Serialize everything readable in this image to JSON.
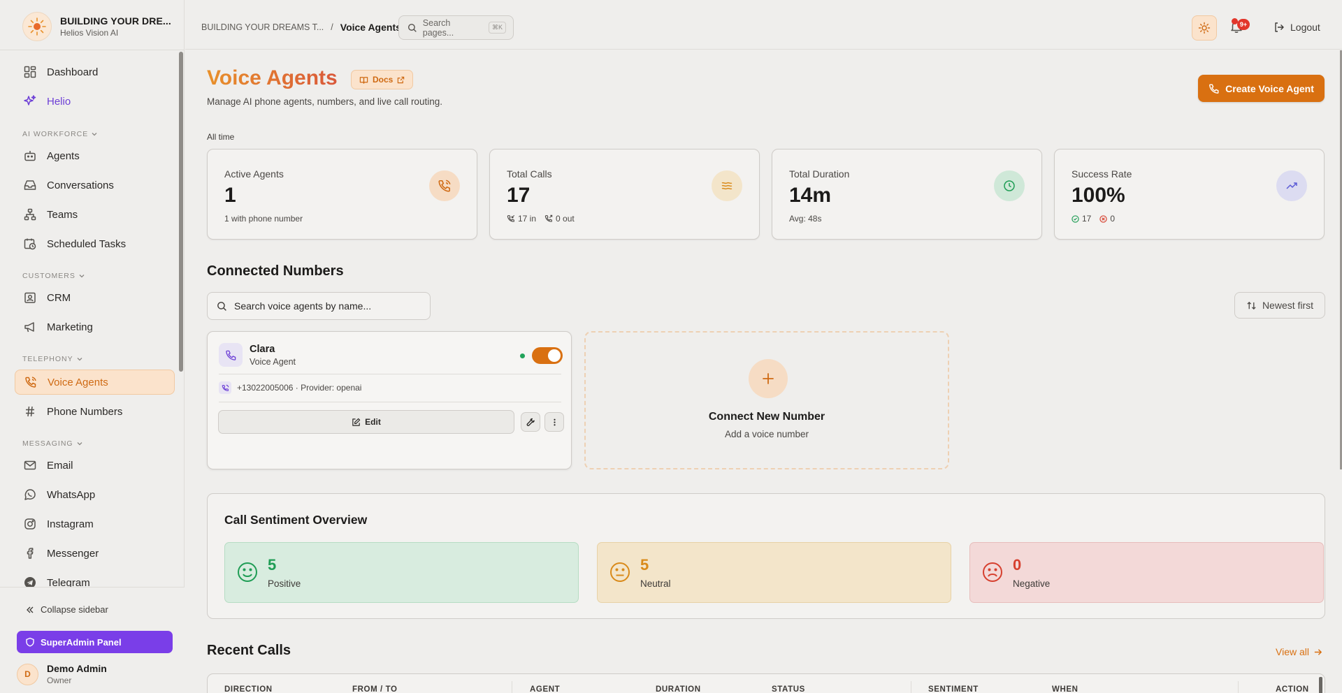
{
  "brand": {
    "name": "BUILDING YOUR DRE...",
    "subtitle": "Helios Vision AI"
  },
  "sidebar": {
    "items": [
      {
        "label": "Dashboard",
        "icon": "dashboard-grid-icon"
      },
      {
        "label": "Helio",
        "icon": "sparkles-icon"
      },
      {
        "label": "Agents",
        "icon": "bot-icon"
      },
      {
        "label": "Conversations",
        "icon": "inbox-icon"
      },
      {
        "label": "Teams",
        "icon": "network-icon"
      },
      {
        "label": "Scheduled Tasks",
        "icon": "calendar-clock-icon"
      },
      {
        "label": "CRM",
        "icon": "contact-icon"
      },
      {
        "label": "Marketing",
        "icon": "megaphone-icon"
      },
      {
        "label": "Voice Agents",
        "icon": "phone-call-icon"
      },
      {
        "label": "Phone Numbers",
        "icon": "hash-icon"
      },
      {
        "label": "Email",
        "icon": "mail-icon"
      },
      {
        "label": "WhatsApp",
        "icon": "whatsapp-icon"
      },
      {
        "label": "Instagram",
        "icon": "instagram-icon"
      },
      {
        "label": "Messenger",
        "icon": "facebook-icon"
      },
      {
        "label": "Telegram",
        "icon": "telegram-icon"
      }
    ],
    "sections": [
      "AI WORKFORCE",
      "CUSTOMERS",
      "TELEPHONY",
      "MESSAGING"
    ],
    "collapse_label": "Collapse sidebar",
    "superadmin_label": "SuperAdmin Panel",
    "user": {
      "initial": "D",
      "name": "Demo Admin",
      "role": "Owner"
    }
  },
  "header": {
    "breadcrumb_root": "BUILDING YOUR DREAMS T...",
    "breadcrumb_sep": "/",
    "breadcrumb_current": "Voice Agents",
    "search_placeholder": "Search pages...",
    "search_shortcut": "⌘K",
    "notification_badge": "9+",
    "logout_label": "Logout"
  },
  "page": {
    "title": "Voice Agents",
    "docs_label": "Docs",
    "subtitle": "Manage AI phone agents, numbers, and live call routing.",
    "create_label": "Create Voice Agent",
    "period": "All time"
  },
  "stats": [
    {
      "label": "Active Agents",
      "value": "1",
      "foot": "1 with phone number",
      "icon": "phone-call-icon"
    },
    {
      "label": "Total Calls",
      "value": "17",
      "foot_in": "17 in",
      "foot_out": "0 out",
      "icon": "waves-icon"
    },
    {
      "label": "Total Duration",
      "value": "14m",
      "foot": "Avg: 48s",
      "icon": "clock-icon"
    },
    {
      "label": "Success Rate",
      "value": "100%",
      "foot_ok": "17",
      "foot_fail": "0",
      "icon": "trending-up-icon"
    }
  ],
  "connected": {
    "title": "Connected Numbers",
    "search_placeholder": "Search voice agents by name...",
    "sort_label": "Newest first",
    "agent": {
      "name": "Clara",
      "role": "Voice Agent",
      "phone_line": "+13022005006 · Provider: openai",
      "enabled": true,
      "edit_label": "Edit"
    },
    "connect_title": "Connect New Number",
    "connect_sub": "Add a voice number"
  },
  "sentiment": {
    "title": "Call Sentiment Overview",
    "positive": {
      "value": "5",
      "label": "Positive"
    },
    "neutral": {
      "value": "5",
      "label": "Neutral"
    },
    "negative": {
      "value": "0",
      "label": "Negative"
    }
  },
  "recent": {
    "title": "Recent Calls",
    "view_all": "View all",
    "columns": [
      "DIRECTION",
      "FROM / TO",
      "AGENT",
      "DURATION",
      "STATUS",
      "SENTIMENT",
      "WHEN",
      "ACTION"
    ]
  },
  "colors": {
    "accent": "#d97011",
    "purple": "#7a3ee8",
    "positive": "#1f9d55",
    "neutral": "#d98a1a",
    "negative": "#d6402f"
  }
}
